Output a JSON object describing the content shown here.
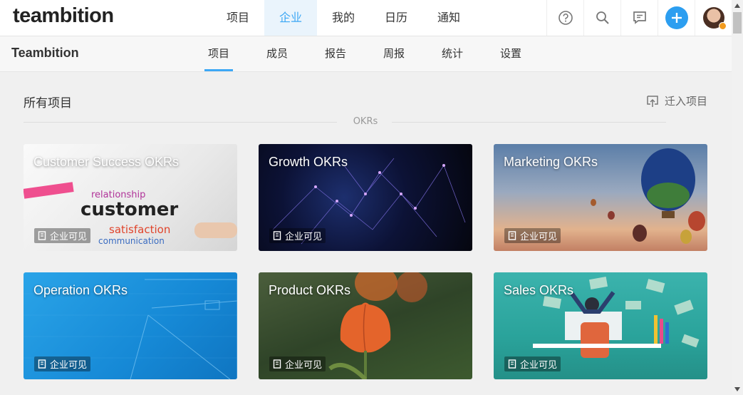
{
  "app": {
    "logo_text": "teambition"
  },
  "top_nav": [
    "项目",
    "企业",
    "我的",
    "日历",
    "通知"
  ],
  "top_nav_active": "企业",
  "top_icons": [
    "help-icon",
    "search-icon",
    "message-icon",
    "add-icon",
    "avatar"
  ],
  "org": {
    "name": "Teambition"
  },
  "sub_nav": [
    "项目",
    "成员",
    "报告",
    "周报",
    "统计",
    "设置"
  ],
  "sub_nav_active": "项目",
  "section": {
    "title": "所有项目",
    "import_label": "迁入项目",
    "group_label": "OKRs"
  },
  "cards": [
    {
      "title": "Customer Success OKRs",
      "visibility": "企业可见"
    },
    {
      "title": "Growth OKRs",
      "visibility": "企业可见"
    },
    {
      "title": "Marketing OKRs",
      "visibility": "企业可见"
    },
    {
      "title": "Operation OKRs",
      "visibility": "企业可见"
    },
    {
      "title": "Product OKRs",
      "visibility": "企业可见"
    },
    {
      "title": "Sales OKRs",
      "visibility": "企业可见"
    }
  ],
  "colors": {
    "accent": "#3da8f5",
    "add_button": "#2c9ef0"
  }
}
